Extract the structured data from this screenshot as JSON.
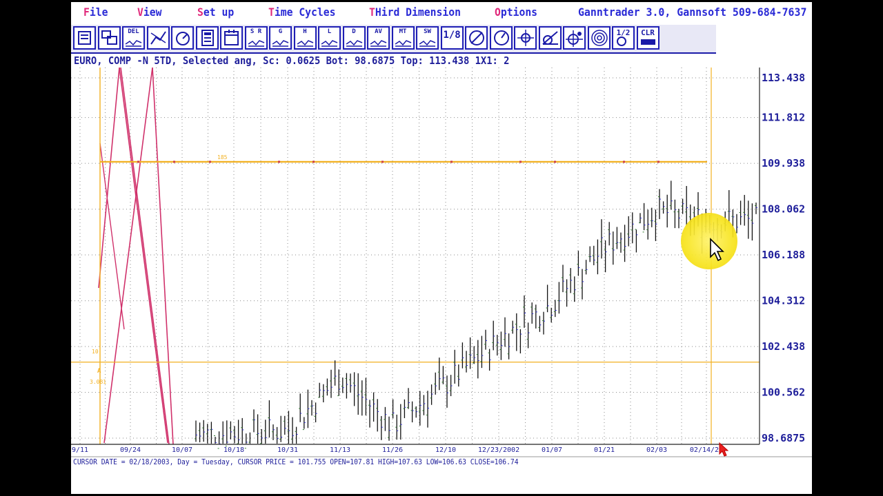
{
  "menu": {
    "file": {
      "hot": "F",
      "rest": "ile"
    },
    "view": {
      "hot": "V",
      "rest": "iew"
    },
    "setup": {
      "hot": "S",
      "rest": "et up"
    },
    "time_cycles": {
      "hot": "T",
      "rest": "ime Cycles"
    },
    "third_dimension": {
      "hot": "T",
      "rest": "Hird Dimension"
    },
    "options": {
      "hot": "O",
      "rest": "ptions"
    }
  },
  "window_title": "Ganntrader 3.0, Gannsoft 509-684-7637",
  "toolbar": {
    "buttons": [
      {
        "name": "print-icon",
        "label": ""
      },
      {
        "name": "windows-icon",
        "label": ""
      },
      {
        "name": "delete-icon",
        "label": "DEL"
      },
      {
        "name": "line-icon",
        "label": ""
      },
      {
        "name": "cycle-icon",
        "label": ""
      },
      {
        "name": "calculator-icon",
        "label": ""
      },
      {
        "name": "calendar-icon",
        "label": ""
      },
      {
        "name": "sr-icon",
        "label": "S R"
      },
      {
        "name": "gann-g-icon",
        "label": "G"
      },
      {
        "name": "gann-h-icon",
        "label": "H"
      },
      {
        "name": "gann-l-icon",
        "label": "L"
      },
      {
        "name": "gann-d-icon",
        "label": "D"
      },
      {
        "name": "average-icon",
        "label": "AV"
      },
      {
        "name": "mt-icon",
        "label": "MT"
      },
      {
        "name": "swing-icon",
        "label": "SW"
      },
      {
        "name": "fraction-icon",
        "label": "1/8"
      },
      {
        "name": "circle-slash-icon",
        "label": ""
      },
      {
        "name": "clock-icon",
        "label": ""
      },
      {
        "name": "crosshair-icon",
        "label": ""
      },
      {
        "name": "angle-icon",
        "label": ""
      },
      {
        "name": "target-move-icon",
        "label": ""
      },
      {
        "name": "spiral-icon",
        "label": ""
      },
      {
        "name": "half-gear-icon",
        "label": "1/2"
      },
      {
        "name": "clear-icon",
        "label": "CLR"
      }
    ]
  },
  "info_line": "EURO, COMP -N 5TD, Selected ang, Sc: 0.0625 Bot: 98.6875 Top: 113.438 1X1: 2",
  "price_axis": {
    "labels": [
      "113.438",
      "111.812",
      "109.938",
      "108.062",
      "106.188",
      "104.312",
      "102.438",
      "100.562",
      "98.6875"
    ],
    "top": 113.438,
    "bottom": 98.6875
  },
  "date_axis": {
    "labels": [
      "9/11",
      "09/24",
      "10/07",
      "10/18",
      "10/31",
      "11/13",
      "11/26",
      "12/10",
      "12/23/2002",
      "01/07",
      "01/21",
      "02/03",
      "02/14/20"
    ]
  },
  "annotations": {
    "level_upper_label": "185",
    "left_small_label": "10",
    "left_a_label": "A",
    "left_value_label": "3.081"
  },
  "status_line": "CURSOR DATE = 02/18/2003, Day = Tuesday, CURSOR PRICE = 101.755 OPEN=107.81 HIGH=107.63 LOW=106.63 CLOSE=106.74",
  "colors": {
    "menu_blue": "#2a2ad6",
    "menu_hotkey": "#e0287a",
    "grid_dots": "#8a8a8a",
    "gann_lines": "#d0306a",
    "level_lines": "#f2b020",
    "price_bars": "#111111",
    "highlight": "#f7e41e"
  },
  "chart_data": {
    "type": "ohlc",
    "x_ticks": [
      "9/11",
      "09/24",
      "10/07",
      "10/18",
      "10/31",
      "11/13",
      "11/26",
      "12/10",
      "12/23/2002",
      "01/07",
      "01/21",
      "02/03",
      "02/14/20"
    ],
    "ylim": [
      98.6875,
      113.438
    ],
    "y_ticks": [
      113.438,
      111.812,
      109.938,
      108.062,
      106.188,
      104.312,
      102.438,
      100.562,
      98.6875
    ],
    "approx_close_path": [
      {
        "x": "10/07",
        "close": 98.8
      },
      {
        "x": "10/31",
        "close": 99.0
      },
      {
        "x": "11/13",
        "close": 101.2
      },
      {
        "x": "11/26",
        "close": 99.2
      },
      {
        "x": "12/10",
        "close": 100.9
      },
      {
        "x": "12/23/2002",
        "close": 102.7
      },
      {
        "x": "01/07",
        "close": 104.2
      },
      {
        "x": "01/21",
        "close": 106.5
      },
      {
        "x": "02/03",
        "close": 108.0
      },
      {
        "x": "02/14/20",
        "close": 107.6
      }
    ],
    "horizontal_levels": [
      110.0,
      101.8
    ],
    "grid": true
  }
}
